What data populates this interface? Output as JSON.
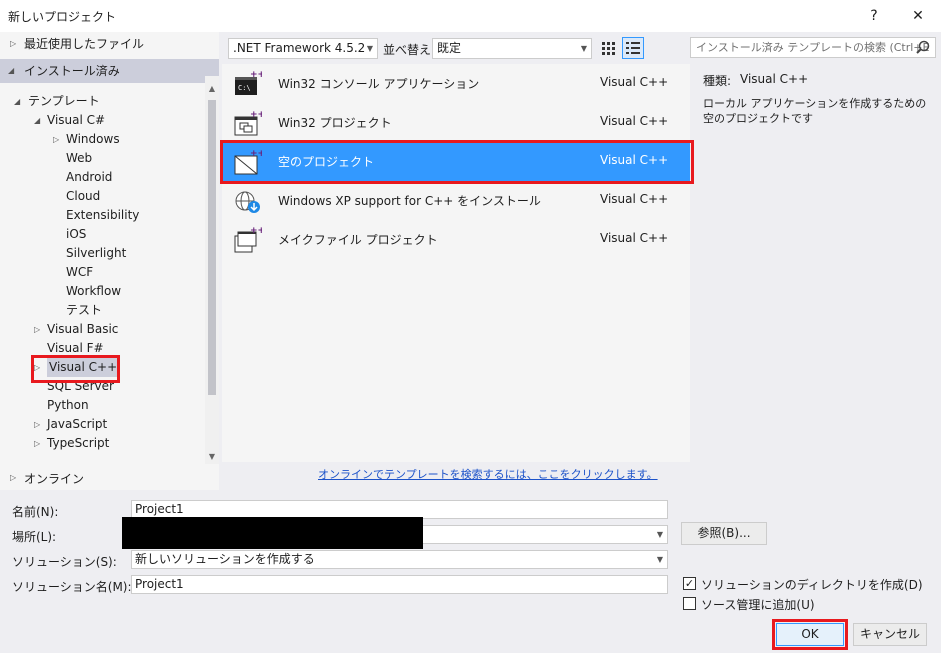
{
  "window": {
    "title": "新しいプロジェクト",
    "help_glyph": "?",
    "close_glyph": "✕"
  },
  "tree": {
    "recent": "最近使用したファイル",
    "installed": "インストール済み",
    "templates": "テンプレート",
    "items": [
      {
        "label": "Visual C#",
        "arrow": "◢"
      },
      {
        "label": "Windows",
        "arrow": "▷"
      },
      {
        "label": "Web",
        "arrow": ""
      },
      {
        "label": "Android",
        "arrow": ""
      },
      {
        "label": "Cloud",
        "arrow": ""
      },
      {
        "label": "Extensibility",
        "arrow": ""
      },
      {
        "label": "iOS",
        "arrow": ""
      },
      {
        "label": "Silverlight",
        "arrow": ""
      },
      {
        "label": "WCF",
        "arrow": ""
      },
      {
        "label": "Workflow",
        "arrow": ""
      },
      {
        "label": "テスト",
        "arrow": ""
      },
      {
        "label": "Visual Basic",
        "arrow": "▷"
      },
      {
        "label": "Visual F#",
        "arrow": ""
      },
      {
        "label": "Visual C++",
        "arrow": "▷"
      },
      {
        "label": "SQL Server",
        "arrow": ""
      },
      {
        "label": "Python",
        "arrow": ""
      },
      {
        "label": "JavaScript",
        "arrow": "▷"
      },
      {
        "label": "TypeScript",
        "arrow": "▷"
      }
    ],
    "online": "オンライン"
  },
  "toolbar": {
    "framework": ".NET Framework 4.5.2",
    "sort_label": "並べ替え:",
    "sort_value": "既定"
  },
  "search": {
    "placeholder": "インストール済み テンプレートの検索 (Ctrl+E"
  },
  "templates": [
    {
      "name": "Win32 コンソール アプリケーション",
      "lang": "Visual C++",
      "icon": "console-app-icon",
      "selected": false
    },
    {
      "name": "Win32 プロジェクト",
      "lang": "Visual C++",
      "icon": "win32-project-icon",
      "selected": false
    },
    {
      "name": "空のプロジェクト",
      "lang": "Visual C++",
      "icon": "empty-project-icon",
      "selected": true
    },
    {
      "name": "Windows XP support for C++ をインストール",
      "lang": "Visual C++",
      "icon": "globe-download-icon",
      "selected": false
    },
    {
      "name": "メイクファイル プロジェクト",
      "lang": "Visual C++",
      "icon": "makefile-project-icon",
      "selected": false
    }
  ],
  "online_link": "オンラインでテンプレートを検索するには、ここをクリックします。",
  "details": {
    "type_label": "種類:",
    "type_value": "Visual C++",
    "description": "ローカル アプリケーションを作成するための空のプロジェクトです"
  },
  "form": {
    "name_label": "名前(N):",
    "name_value": "Project1",
    "location_label": "場所(L):",
    "solution_label": "ソリューション(S):",
    "solution_value": "新しいソリューションを作成する",
    "solution_name_label": "ソリューション名(M):",
    "solution_name_value": "Project1",
    "browse_label": "参照(B)...",
    "create_dir_label": "ソリューションのディレクトリを作成(D)",
    "create_dir_checked": true,
    "source_control_label": "ソース管理に追加(U)",
    "source_control_checked": false,
    "ok_label": "OK",
    "cancel_label": "キャンセル"
  },
  "colors": {
    "accent": "#3399ff",
    "highlight": "#e8191e",
    "link": "#1c52c9"
  }
}
